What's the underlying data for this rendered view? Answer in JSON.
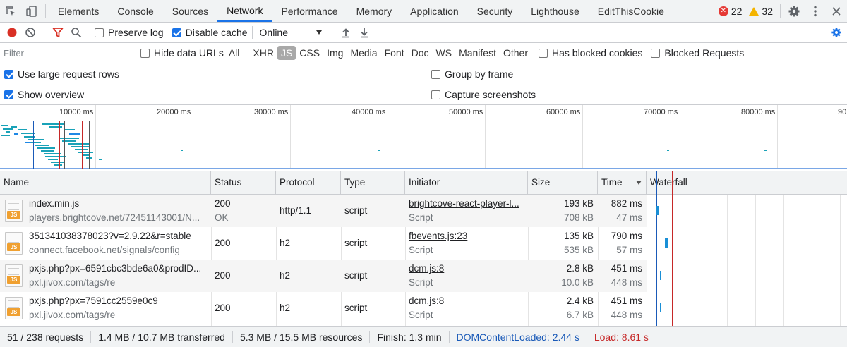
{
  "tabs": [
    "Elements",
    "Console",
    "Sources",
    "Network",
    "Performance",
    "Memory",
    "Application",
    "Security",
    "Lighthouse",
    "EditThisCookie"
  ],
  "active_tab": "Network",
  "counts": {
    "errors": "22",
    "warnings": "32"
  },
  "toolbar": {
    "preserve_log": "Preserve log",
    "disable_cache": "Disable cache",
    "throttle": "Online"
  },
  "filter": {
    "placeholder": "Filter",
    "hide_data_urls": "Hide data URLs",
    "types": [
      "All",
      "XHR",
      "JS",
      "CSS",
      "Img",
      "Media",
      "Font",
      "Doc",
      "WS",
      "Manifest",
      "Other"
    ],
    "active_type": "JS",
    "has_blocked_cookies": "Has blocked cookies",
    "blocked_requests": "Blocked Requests"
  },
  "settings": {
    "large_rows": "Use large request rows",
    "show_overview": "Show overview",
    "group_by_frame": "Group by frame",
    "capture_screenshots": "Capture screenshots"
  },
  "overview": {
    "labels": [
      "10000 ms",
      "20000 ms",
      "30000 ms",
      "40000 ms",
      "50000 ms",
      "60000 ms",
      "70000 ms",
      "80000 ms",
      "90"
    ]
  },
  "columns": [
    "Name",
    "Status",
    "Protocol",
    "Type",
    "Initiator",
    "Size",
    "Time",
    "Waterfall"
  ],
  "requests": [
    {
      "name": "index.min.js",
      "domain": "players.brightcove.net/72451143001/N...",
      "status": "200",
      "status_text": "OK",
      "protocol": "http/1.1",
      "type": "script",
      "initiator": "brightcove-react-player-l...",
      "initiator_type": "Script",
      "size": "193 kB",
      "resource_size": "708 kB",
      "time": "882 ms",
      "latency": "47 ms"
    },
    {
      "name": "351341038378023?v=2.9.22&r=stable",
      "domain": "connect.facebook.net/signals/config",
      "status": "200",
      "status_text": "",
      "protocol": "h2",
      "type": "script",
      "initiator": "fbevents.js:23",
      "initiator_type": "Script",
      "size": "135 kB",
      "resource_size": "535 kB",
      "time": "790 ms",
      "latency": "57 ms"
    },
    {
      "name": "pxjs.php?px=6591cbc3bde6a0&prodID...",
      "domain": "pxl.jivox.com/tags/re",
      "status": "200",
      "status_text": "",
      "protocol": "h2",
      "type": "script",
      "initiator": "dcm.js:8",
      "initiator_type": "Script",
      "size": "2.8 kB",
      "resource_size": "10.0 kB",
      "time": "451 ms",
      "latency": "448 ms"
    },
    {
      "name": "pxjs.php?px=7591cc2559e0c9",
      "domain": "pxl.jivox.com/tags/re",
      "status": "200",
      "status_text": "",
      "protocol": "h2",
      "type": "script",
      "initiator": "dcm.js:8",
      "initiator_type": "Script",
      "size": "2.4 kB",
      "resource_size": "6.7 kB",
      "time": "451 ms",
      "latency": "448 ms"
    }
  ],
  "statusbar": {
    "requests": "51 / 238 requests",
    "transferred": "1.4 MB / 10.7 MB transferred",
    "resources": "5.3 MB / 15.5 MB resources",
    "finish": "Finish: 1.3 min",
    "dom_content_loaded": "DOMContentLoaded: 2.44 s",
    "load": "Load: 8.61 s"
  },
  "colors": {
    "accent": "#1a73e8",
    "dcl": "#1a5ab8",
    "load": "#c62828",
    "record": "#d93025"
  }
}
